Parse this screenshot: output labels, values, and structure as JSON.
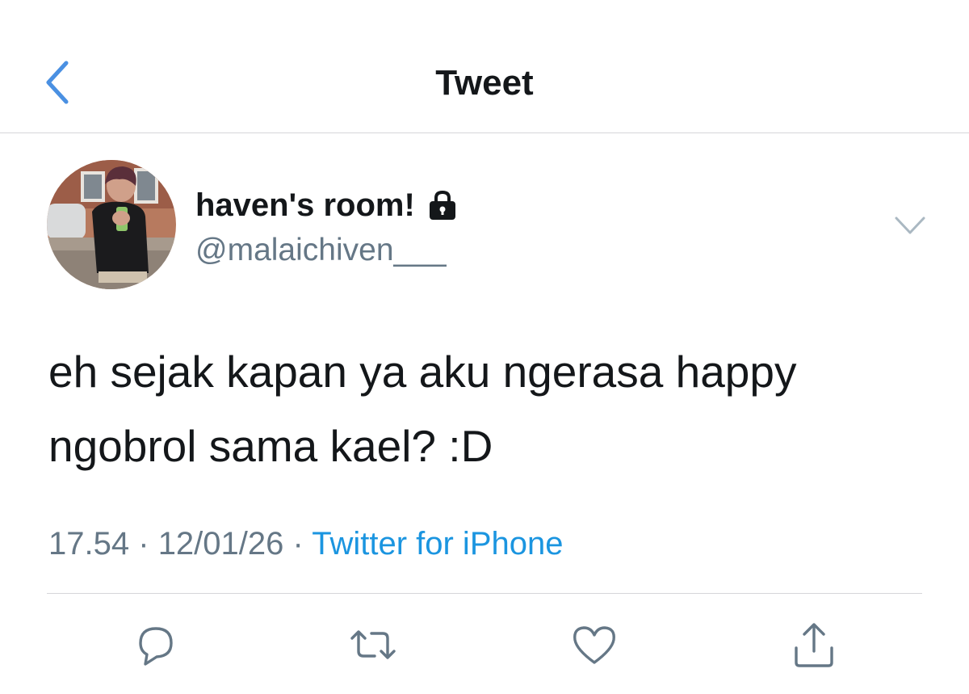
{
  "nav": {
    "title": "Tweet",
    "back_icon": "chevron-left-icon",
    "accent_color": "#4a90e2"
  },
  "author": {
    "display_name": "haven's room!",
    "protected_icon": "lock-icon",
    "handle": "@malaichiven___",
    "avatar_icon": "profile-photo"
  },
  "tweet": {
    "text_lines": [
      "eh sejak kapan ya aku ngerasa happy",
      "ngobrol sama kael? :D"
    ],
    "time": "17.54",
    "date": "12/01/26",
    "separator": "·",
    "source": "Twitter for iPhone",
    "source_color": "#1b95e0"
  },
  "actions": {
    "reply_icon": "reply-icon",
    "retweet_icon": "retweet-icon",
    "like_icon": "heart-icon",
    "share_icon": "share-icon"
  },
  "colors": {
    "text": "#14171a",
    "secondary": "#657786",
    "divider": "#d6d6d9",
    "icon_gray": "#657786"
  }
}
